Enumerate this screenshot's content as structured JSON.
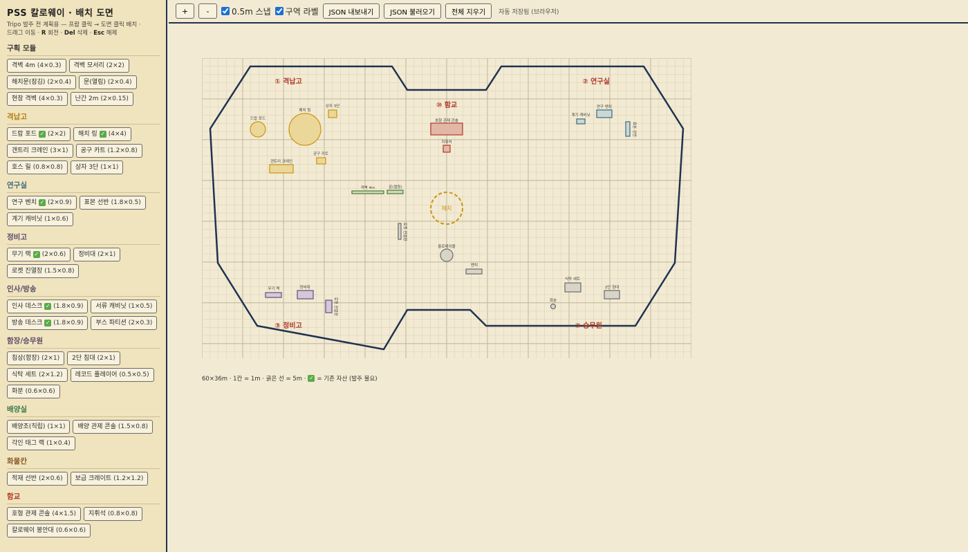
{
  "app": {
    "title": "PSS 칼로웨이 · 배치 도면",
    "help_line1": "Tripo 발주 전 계획용 — 프랍 클릭 → 도면 클릭 배치 ·",
    "help_drag": "드래그 이동 ·",
    "help_r_key": "R",
    "help_rotate": "회전 ·",
    "help_del_key": "Del",
    "help_delete": "삭제 ·",
    "help_esc_key": "Esc",
    "help_cancel": "해제"
  },
  "toolbar": {
    "zoom_in": "+",
    "zoom_out": "-",
    "snap_label": "0.5m 스냅",
    "snap_checked": true,
    "zone_label": "구역 라벨",
    "zone_checked": true,
    "export_json": "JSON 내보내기",
    "import_json": "JSON 불러오기",
    "clear_all": "전체 지우기",
    "autosave": "자동 저장됨 (브라우저)"
  },
  "categories": [
    {
      "title": "구획 모듈",
      "color": "#3a3a3a",
      "items": [
        {
          "name": "격벽 4m",
          "size": "(4×0.3)",
          "owned": false
        },
        {
          "name": "격벽 모서리",
          "size": "(2×2)",
          "owned": false
        },
        {
          "name": "해치문(잠김)",
          "size": "(2×0.4)",
          "owned": false
        },
        {
          "name": "문(열림)",
          "size": "(2×0.4)",
          "owned": false
        },
        {
          "name": "현창 격벽",
          "size": "(4×0.3)",
          "owned": false
        },
        {
          "name": "난간 2m",
          "size": "(2×0.15)",
          "owned": false
        }
      ]
    },
    {
      "title": "격납고",
      "color": "#b07a12",
      "items": [
        {
          "name": "드랍 포드",
          "size": "(2×2)",
          "owned": true
        },
        {
          "name": "해치 링",
          "size": "(4×4)",
          "owned": true
        },
        {
          "name": "갠트리 크레인",
          "size": "(3×1)",
          "owned": false
        },
        {
          "name": "공구 카트",
          "size": "(1.2×0.8)",
          "owned": false
        },
        {
          "name": "호스 릴",
          "size": "(0.8×0.8)",
          "owned": false
        },
        {
          "name": "상자 3단",
          "size": "(1×1)",
          "owned": false
        }
      ]
    },
    {
      "title": "연구실",
      "color": "#3b6a7a",
      "items": [
        {
          "name": "연구 벤치",
          "size": "(2×0.9)",
          "owned": true
        },
        {
          "name": "표본 선반",
          "size": "(1.8×0.5)",
          "owned": false
        },
        {
          "name": "계기 캐비닛",
          "size": "(1×0.6)",
          "owned": false
        }
      ]
    },
    {
      "title": "정비고",
      "color": "#5a4a6a",
      "items": [
        {
          "name": "무기 랙",
          "size": "(2×0.6)",
          "owned": true
        },
        {
          "name": "정비대",
          "size": "(2×1)",
          "owned": false
        },
        {
          "name": "로켓 진열장",
          "size": "(1.5×0.8)",
          "owned": false
        }
      ]
    },
    {
      "title": "인사/방송",
      "color": "#5a4a6a",
      "items": [
        {
          "name": "인사 데스크",
          "size": "(1.8×0.9)",
          "owned": true
        },
        {
          "name": "서류 캐비닛",
          "size": "(1×0.5)",
          "owned": false
        },
        {
          "name": "방송 데스크",
          "size": "(1.8×0.9)",
          "owned": true
        },
        {
          "name": "부스 파티션",
          "size": "(2×0.3)",
          "owned": false
        }
      ]
    },
    {
      "title": "함장/승무원",
      "color": "#5a4a6a",
      "items": [
        {
          "name": "침상(함장)",
          "size": "(2×1)",
          "owned": false
        },
        {
          "name": "2단 침대",
          "size": "(2×1)",
          "owned": false
        },
        {
          "name": "식탁 세트",
          "size": "(2×1.2)",
          "owned": false
        },
        {
          "name": "레코드 플레이어",
          "size": "(0.5×0.5)",
          "owned": false
        },
        {
          "name": "화분",
          "size": "(0.6×0.6)",
          "owned": false
        }
      ]
    },
    {
      "title": "배양실",
      "color": "#3a7a4a",
      "items": [
        {
          "name": "배양조(직립)",
          "size": "(1×1)",
          "owned": false
        },
        {
          "name": "배양 관제 콘솔",
          "size": "(1.5×0.8)",
          "owned": false
        },
        {
          "name": "각인 태그 랙",
          "size": "(1×0.4)",
          "owned": false
        }
      ]
    },
    {
      "title": "화물칸",
      "color": "#8a5a2a",
      "items": [
        {
          "name": "적재 선반",
          "size": "(2×0.6)",
          "owned": false
        },
        {
          "name": "보급 크레이트",
          "size": "(1.2×1.2)",
          "owned": false
        }
      ]
    },
    {
      "title": "함교",
      "color": "#b03a2a",
      "items": [
        {
          "name": "호형 관제 콘솔",
          "size": "(4×1.5)",
          "owned": false
        },
        {
          "name": "지휘석",
          "size": "(0.8×0.8)",
          "owned": false
        },
        {
          "name": "칼로웨이 봉안대",
          "size": "(0.6×0.6)",
          "owned": false
        }
      ]
    }
  ],
  "floor": {
    "zones": [
      {
        "num": "①",
        "label": "격납고"
      },
      {
        "num": "②",
        "label": "연구실"
      },
      {
        "num": "⑩",
        "label": "함교"
      },
      {
        "num": "③",
        "label": "정비고"
      },
      {
        "num": "⑦",
        "label": "승무원"
      }
    ],
    "hatch_label": "해치",
    "props": [
      {
        "label": "드랍 포드",
        "cat": "hangar"
      },
      {
        "label": "해치 링",
        "cat": "hangar"
      },
      {
        "label": "상자 3단",
        "cat": "hangar"
      },
      {
        "label": "공구 카트",
        "cat": "hangar"
      },
      {
        "label": "갠트리 크레인",
        "cat": "hangar"
      },
      {
        "label": "호형 관제 콘솔",
        "cat": "bridge"
      },
      {
        "label": "지휘석",
        "cat": "bridge"
      },
      {
        "label": "계기 캐비닛",
        "cat": "lab"
      },
      {
        "label": "연구 벤치",
        "cat": "lab"
      },
      {
        "label": "표본 선반",
        "cat": "lab"
      },
      {
        "label": "격벽 4m",
        "cat": "module"
      },
      {
        "label": "문(열림)",
        "cat": "module"
      },
      {
        "label": "로켓 진열장",
        "cat": "gray"
      },
      {
        "label": "홀로테이블",
        "cat": "gray"
      },
      {
        "label": "벤치",
        "cat": "gray"
      },
      {
        "label": "무기 랙",
        "cat": "maint"
      },
      {
        "label": "정비대",
        "cat": "maint"
      },
      {
        "label": "로켓 진열장",
        "cat": "maint"
      },
      {
        "label": "식탁 세트",
        "cat": "gray"
      },
      {
        "label": "2단 침대",
        "cat": "gray"
      },
      {
        "label": "화분",
        "cat": "gray"
      }
    ]
  },
  "legend": {
    "text_before": "60×36m · 1칸 = 1m · 굵은 선 = 5m ·",
    "text_after": "= 기존 자산 (발주 불요)"
  },
  "colors": {
    "hull": "#1f3350",
    "hangar": "#c8960f",
    "bridge": "#b03a2a",
    "lab": "#3b6a7a",
    "maint": "#6a4a7a",
    "module": "#4a7a3a",
    "gray": "#6a6a6a",
    "zone_label": "#b03a2a",
    "owned_badge": "#5aaa4a"
  }
}
